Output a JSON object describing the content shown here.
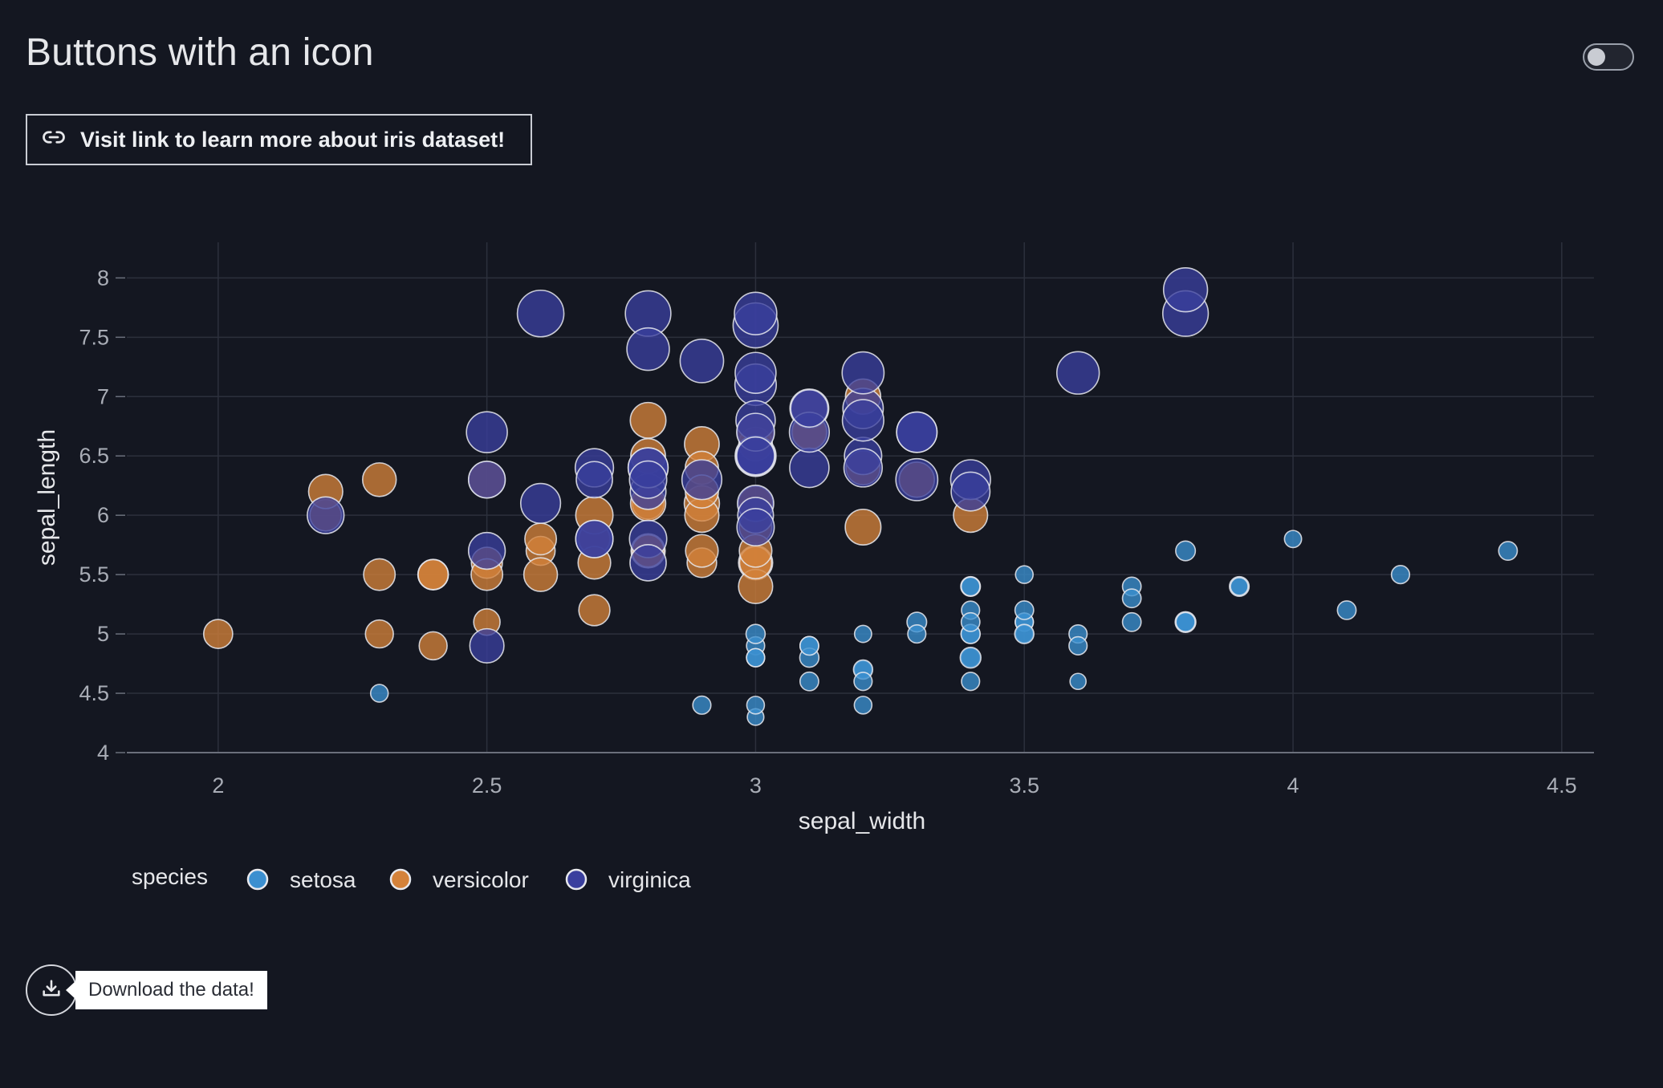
{
  "page": {
    "title": "Buttons with an icon",
    "link_button_label": "Visit link to learn more about iris dataset!",
    "download_tooltip": "Download the data!",
    "theme_toggle_on": false
  },
  "icons": {
    "link_button": "link-icon",
    "download_button": "download-icon"
  },
  "chart_data": {
    "type": "scatter",
    "title": "",
    "xlabel": "sepal_width",
    "ylabel": "sepal_length",
    "xlim": [
      1.83,
      4.56
    ],
    "ylim": [
      4.0,
      8.3
    ],
    "xticks": [
      2,
      2.5,
      3,
      3.5,
      4,
      4.5
    ],
    "xtick_labels": [
      "2",
      "2.5",
      "3",
      "3.5",
      "4",
      "4.5"
    ],
    "yticks": [
      4,
      4.5,
      5,
      5.5,
      6,
      6.5,
      7,
      7.5,
      8
    ],
    "ytick_labels": [
      "4",
      "4.5",
      "5",
      "5.5",
      "6",
      "6.5",
      "7",
      "7.5",
      "8"
    ],
    "grid": true,
    "legend_title": "species",
    "legend_position": "bottom-left",
    "marker_size_encodes": "petal_length",
    "series": [
      {
        "name": "setosa",
        "color": "#3b8fd0",
        "points": [
          [
            3.5,
            5.1
          ],
          [
            3.0,
            4.9
          ],
          [
            3.2,
            4.7
          ],
          [
            3.1,
            4.6
          ],
          [
            3.6,
            5.0
          ],
          [
            3.9,
            5.4
          ],
          [
            3.4,
            4.6
          ],
          [
            3.4,
            5.0
          ],
          [
            2.9,
            4.4
          ],
          [
            3.1,
            4.9
          ],
          [
            3.7,
            5.4
          ],
          [
            3.4,
            4.8
          ],
          [
            3.0,
            4.8
          ],
          [
            3.0,
            4.3
          ],
          [
            4.0,
            5.8
          ],
          [
            4.4,
            5.7
          ],
          [
            3.9,
            5.4
          ],
          [
            3.5,
            5.1
          ],
          [
            3.8,
            5.7
          ],
          [
            3.8,
            5.1
          ],
          [
            3.4,
            5.4
          ],
          [
            3.7,
            5.1
          ],
          [
            3.6,
            4.6
          ],
          [
            3.3,
            5.1
          ],
          [
            3.4,
            4.8
          ],
          [
            3.0,
            5.0
          ],
          [
            3.4,
            5.0
          ],
          [
            3.5,
            5.2
          ],
          [
            3.4,
            5.2
          ],
          [
            3.2,
            4.7
          ],
          [
            3.1,
            4.8
          ],
          [
            3.4,
            5.4
          ],
          [
            4.1,
            5.2
          ],
          [
            4.2,
            5.5
          ],
          [
            3.1,
            4.9
          ],
          [
            3.2,
            5.0
          ],
          [
            3.5,
            5.5
          ],
          [
            3.6,
            4.9
          ],
          [
            3.0,
            4.4
          ],
          [
            3.4,
            5.1
          ],
          [
            3.5,
            5.0
          ],
          [
            2.3,
            4.5
          ],
          [
            3.2,
            4.4
          ],
          [
            3.5,
            5.0
          ],
          [
            3.8,
            5.1
          ],
          [
            3.0,
            4.8
          ],
          [
            3.8,
            5.1
          ],
          [
            3.2,
            4.6
          ],
          [
            3.7,
            5.3
          ],
          [
            3.3,
            5.0
          ]
        ],
        "sizes": [
          1.4,
          1.4,
          1.3,
          1.5,
          1.4,
          1.7,
          1.4,
          1.5,
          1.4,
          1.5,
          1.5,
          1.6,
          1.4,
          1.1,
          1.2,
          1.5,
          1.3,
          1.4,
          1.7,
          1.5,
          1.7,
          1.5,
          1.0,
          1.7,
          1.9,
          1.6,
          1.6,
          1.5,
          1.4,
          1.6,
          1.6,
          1.5,
          1.5,
          1.4,
          1.5,
          1.2,
          1.3,
          1.4,
          1.3,
          1.5,
          1.3,
          1.3,
          1.3,
          1.6,
          1.9,
          1.4,
          1.6,
          1.4,
          1.5,
          1.4
        ]
      },
      {
        "name": "versicolor",
        "color": "#d4823a",
        "points": [
          [
            3.2,
            7.0
          ],
          [
            3.2,
            6.4
          ],
          [
            3.1,
            6.9
          ],
          [
            2.3,
            5.5
          ],
          [
            2.8,
            6.5
          ],
          [
            2.8,
            5.7
          ],
          [
            3.3,
            6.3
          ],
          [
            2.4,
            4.9
          ],
          [
            2.9,
            6.6
          ],
          [
            2.7,
            5.2
          ],
          [
            2.0,
            5.0
          ],
          [
            3.0,
            5.9
          ],
          [
            2.2,
            6.0
          ],
          [
            2.9,
            6.1
          ],
          [
            2.9,
            5.6
          ],
          [
            3.1,
            6.7
          ],
          [
            3.0,
            5.6
          ],
          [
            2.7,
            5.8
          ],
          [
            2.2,
            6.2
          ],
          [
            2.5,
            5.6
          ],
          [
            3.2,
            5.9
          ],
          [
            2.8,
            6.1
          ],
          [
            2.5,
            6.3
          ],
          [
            2.8,
            6.1
          ],
          [
            2.9,
            6.4
          ],
          [
            3.0,
            6.6
          ],
          [
            2.8,
            6.8
          ],
          [
            3.0,
            6.7
          ],
          [
            2.9,
            6.0
          ],
          [
            2.6,
            5.7
          ],
          [
            2.4,
            5.5
          ],
          [
            2.4,
            5.5
          ],
          [
            2.7,
            5.8
          ],
          [
            2.7,
            6.0
          ],
          [
            3.0,
            5.4
          ],
          [
            3.4,
            6.0
          ],
          [
            3.1,
            6.7
          ],
          [
            2.3,
            6.3
          ],
          [
            3.0,
            5.6
          ],
          [
            2.5,
            5.5
          ],
          [
            2.6,
            5.5
          ],
          [
            3.0,
            6.1
          ],
          [
            2.6,
            5.8
          ],
          [
            2.3,
            5.0
          ],
          [
            2.7,
            5.6
          ],
          [
            3.0,
            5.7
          ],
          [
            2.9,
            5.7
          ],
          [
            2.9,
            6.2
          ],
          [
            2.5,
            5.1
          ],
          [
            2.8,
            5.7
          ]
        ],
        "sizes": [
          4.7,
          4.5,
          4.9,
          4.0,
          4.6,
          4.5,
          4.7,
          3.3,
          4.6,
          3.9,
          3.5,
          4.2,
          4.0,
          4.7,
          3.6,
          4.4,
          4.5,
          4.1,
          4.5,
          3.9,
          4.8,
          4.0,
          4.9,
          4.7,
          4.3,
          4.4,
          4.8,
          5.0,
          4.5,
          3.5,
          3.8,
          3.7,
          3.9,
          5.1,
          4.5,
          4.5,
          4.7,
          4.4,
          4.1,
          4.0,
          4.4,
          4.6,
          4.0,
          3.3,
          4.2,
          4.2,
          4.2,
          4.3,
          3.0,
          4.1
        ]
      },
      {
        "name": "virginica",
        "color": "#3a3f9e",
        "points": [
          [
            3.3,
            6.3
          ],
          [
            2.7,
            5.8
          ],
          [
            3.0,
            7.1
          ],
          [
            2.9,
            6.3
          ],
          [
            3.0,
            6.5
          ],
          [
            3.0,
            7.6
          ],
          [
            2.5,
            4.9
          ],
          [
            2.9,
            7.3
          ],
          [
            2.5,
            6.7
          ],
          [
            3.6,
            7.2
          ],
          [
            3.2,
            6.5
          ],
          [
            2.7,
            6.4
          ],
          [
            3.0,
            6.8
          ],
          [
            2.5,
            5.7
          ],
          [
            2.8,
            5.8
          ],
          [
            3.2,
            6.4
          ],
          [
            3.0,
            6.5
          ],
          [
            3.8,
            7.7
          ],
          [
            2.6,
            7.7
          ],
          [
            2.2,
            6.0
          ],
          [
            3.2,
            6.9
          ],
          [
            2.8,
            5.6
          ],
          [
            2.8,
            7.7
          ],
          [
            2.7,
            6.3
          ],
          [
            3.3,
            6.7
          ],
          [
            3.2,
            7.2
          ],
          [
            2.8,
            6.2
          ],
          [
            3.0,
            6.1
          ],
          [
            2.8,
            6.4
          ],
          [
            3.0,
            7.2
          ],
          [
            2.8,
            7.4
          ],
          [
            3.8,
            7.9
          ],
          [
            2.8,
            6.4
          ],
          [
            2.8,
            6.3
          ],
          [
            2.6,
            6.1
          ],
          [
            3.0,
            7.7
          ],
          [
            3.4,
            6.3
          ],
          [
            3.1,
            6.4
          ],
          [
            3.0,
            6.0
          ],
          [
            3.1,
            6.9
          ],
          [
            3.1,
            6.7
          ],
          [
            3.1,
            6.9
          ],
          [
            2.7,
            5.8
          ],
          [
            3.2,
            6.8
          ],
          [
            3.3,
            6.7
          ],
          [
            3.0,
            6.7
          ],
          [
            2.5,
            6.3
          ],
          [
            3.0,
            6.5
          ],
          [
            3.4,
            6.2
          ],
          [
            3.0,
            5.9
          ]
        ],
        "sizes": [
          6.0,
          5.1,
          5.9,
          5.6,
          5.8,
          6.6,
          4.5,
          6.3,
          5.8,
          6.1,
          5.1,
          5.3,
          5.5,
          5.0,
          5.1,
          5.3,
          5.5,
          6.7,
          6.9,
          5.0,
          5.7,
          4.9,
          6.7,
          4.9,
          5.7,
          6.0,
          4.8,
          4.9,
          5.6,
          5.8,
          6.1,
          6.4,
          5.6,
          5.1,
          5.6,
          6.1,
          5.6,
          5.5,
          4.8,
          5.4,
          5.6,
          5.1,
          5.1,
          5.9,
          5.7,
          5.2,
          5.0,
          5.2,
          5.4,
          5.1
        ]
      }
    ]
  }
}
